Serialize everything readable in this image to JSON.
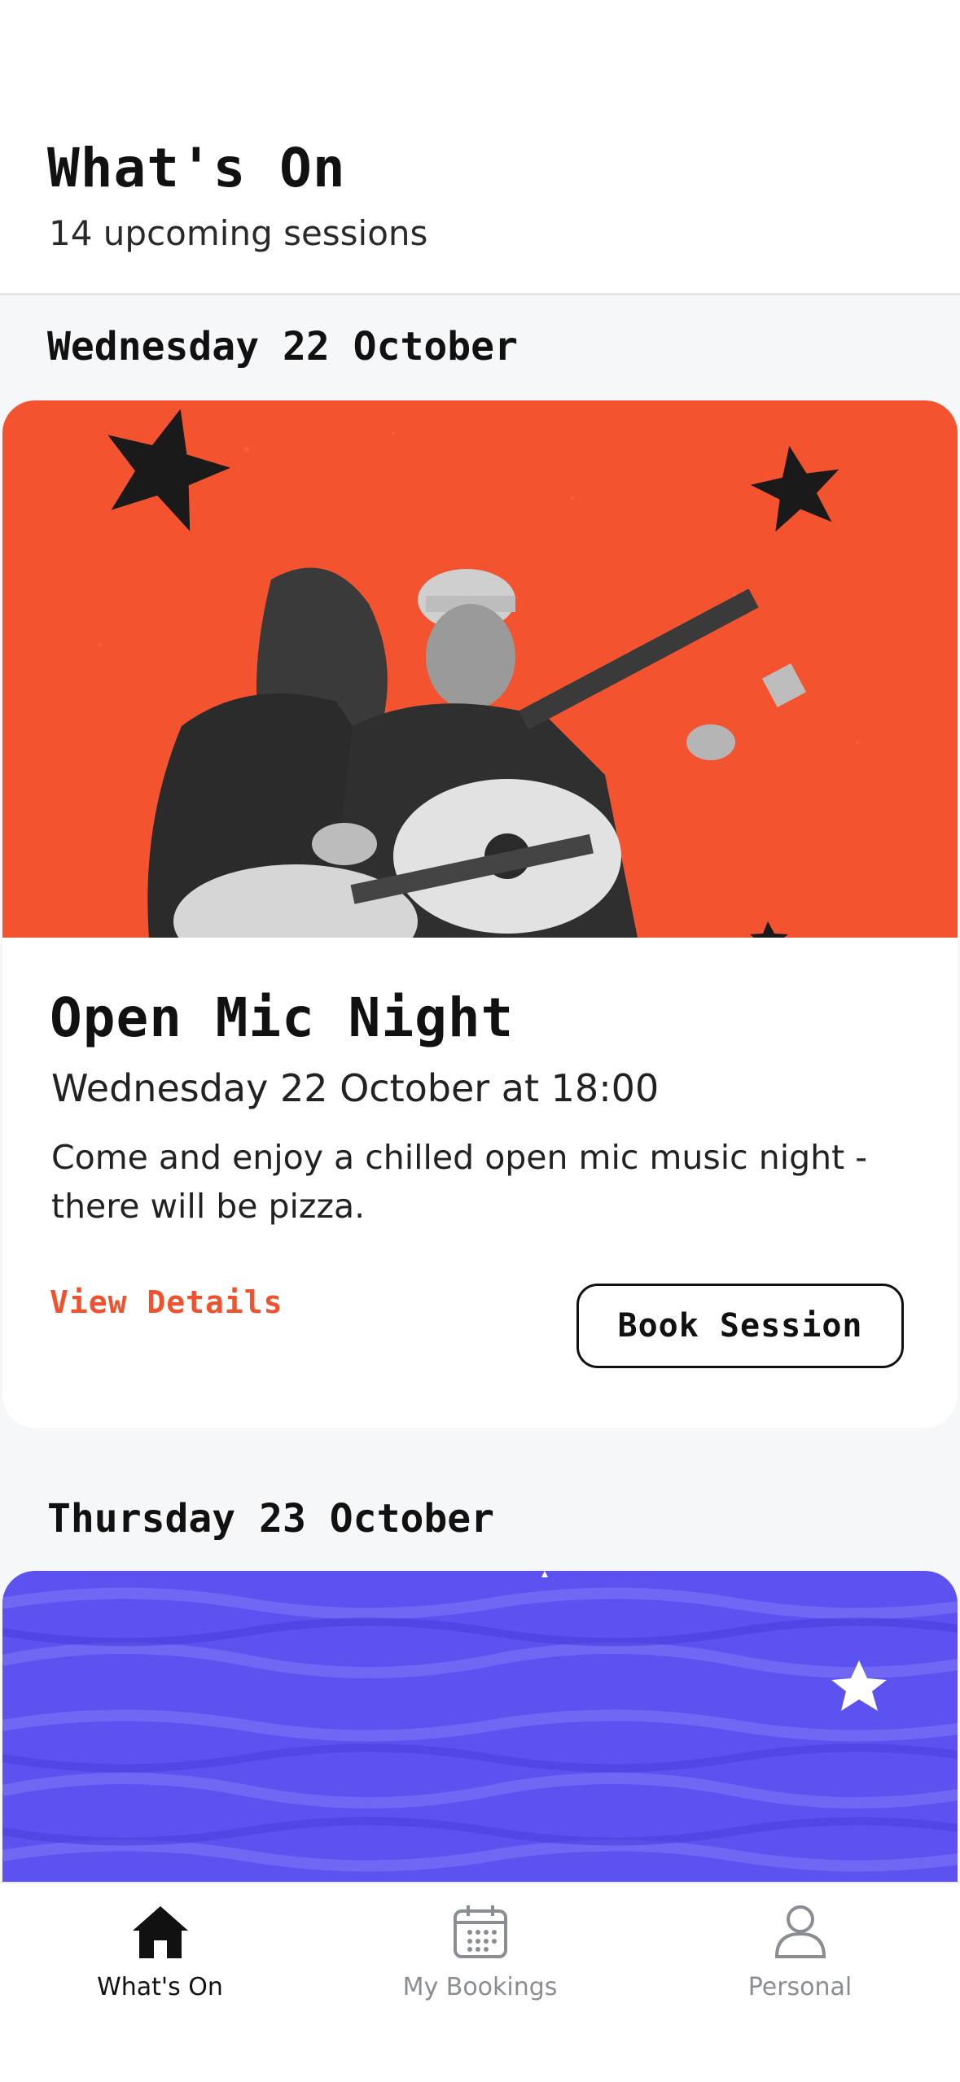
{
  "header": {
    "title": "What's On",
    "subtitle": "14 upcoming sessions"
  },
  "sections": [
    {
      "date": "Wednesday 22 October",
      "event": {
        "title": "Open Mic Night",
        "datetime": "Wednesday 22 October at 18:00",
        "description": "Come and enjoy a chilled open mic music night - there will be pizza.",
        "view_details_label": "View Details",
        "book_label": "Book Session",
        "image_bg_color": "#f4532f"
      }
    },
    {
      "date": "Thursday 23 October",
      "event": {
        "image_bg_color": "#5b52f0"
      }
    }
  ],
  "colors": {
    "accent": "#f0522f",
    "background": "#f6f7f9",
    "text": "#111111",
    "nav_inactive": "#8a8d92"
  },
  "bottom_nav": {
    "items": [
      {
        "label": "What's On",
        "icon": "home-icon",
        "active": true
      },
      {
        "label": "My Bookings",
        "icon": "calendar-icon",
        "active": false
      },
      {
        "label": "Personal",
        "icon": "person-icon",
        "active": false
      }
    ]
  }
}
